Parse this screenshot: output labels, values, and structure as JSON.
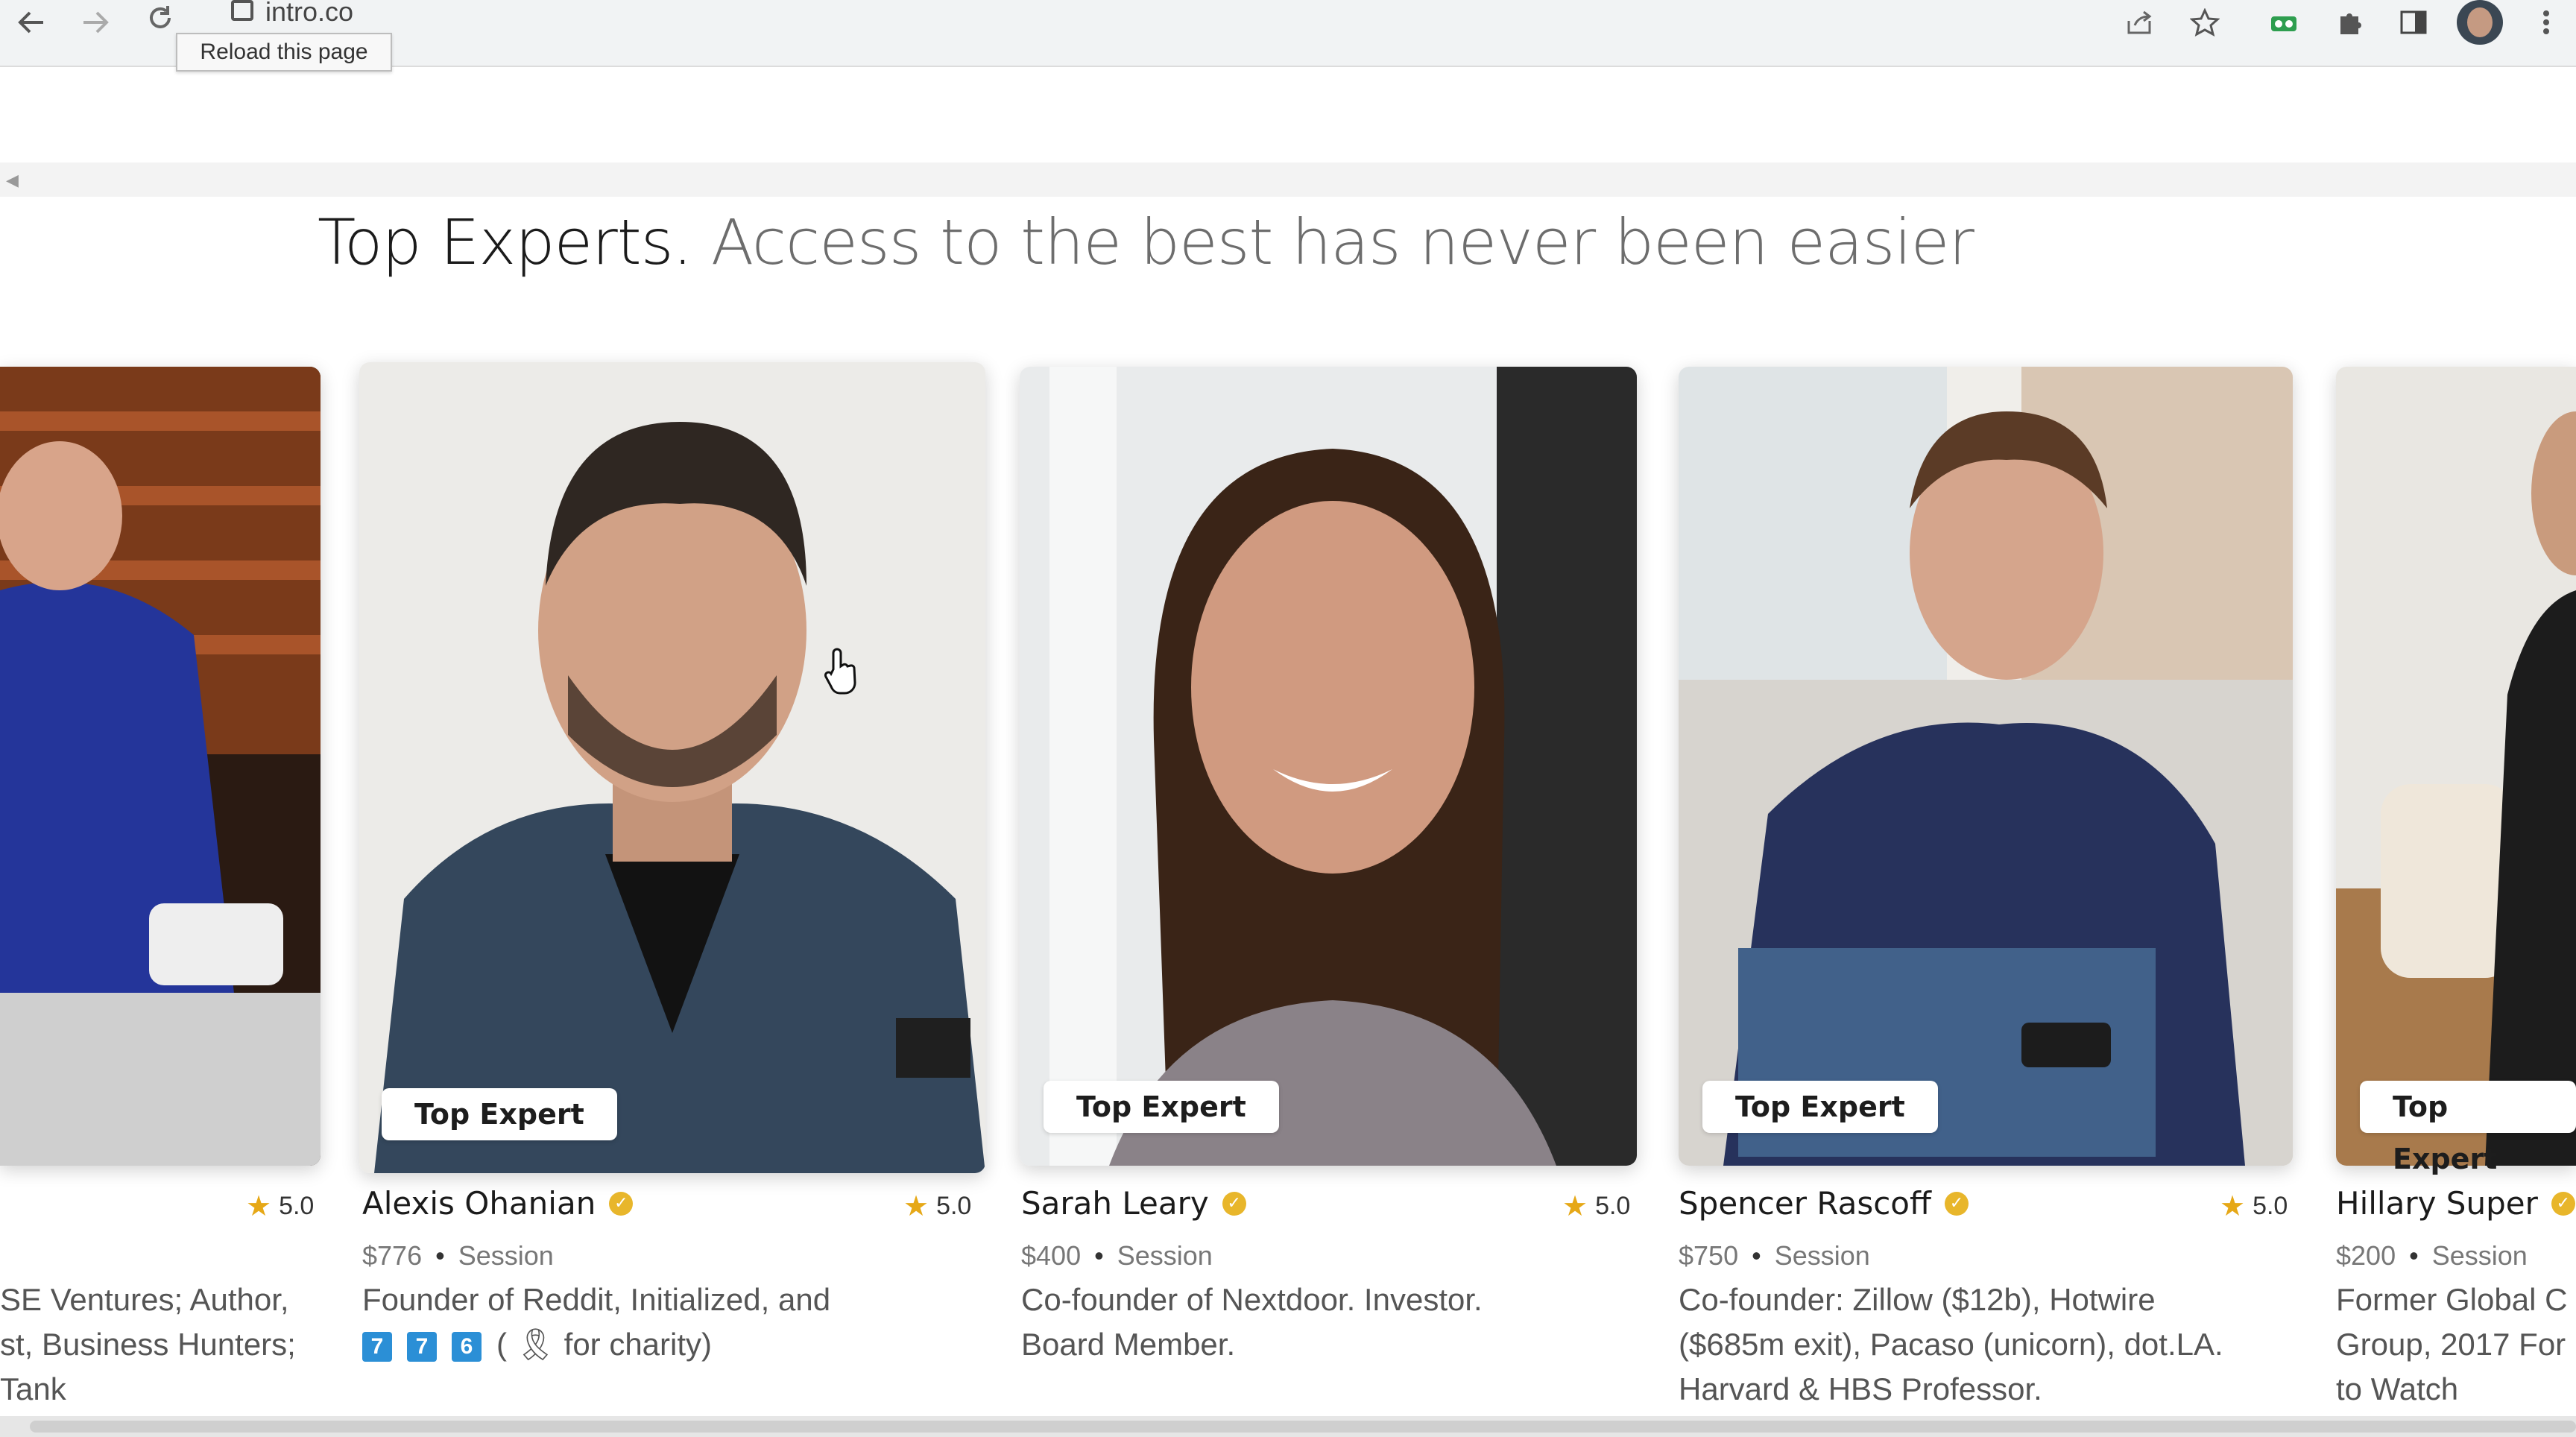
{
  "browser": {
    "url_text": "intro.co",
    "tooltip": "Reload this page"
  },
  "headline": {
    "strong": "Top Experts.",
    "light": "Access to the best has never been easier"
  },
  "badge_label": "Top Expert",
  "star_icon": "★",
  "experts": [
    {
      "rating": "5.0",
      "desc_line1": "SE Ventures; Author,",
      "desc_line2": "st, Business Hunters;",
      "desc_line3": "Tank"
    },
    {
      "name": "Alexis Ohanian",
      "rating": "5.0",
      "price": "$776",
      "unit": "Session",
      "desc_line1": "Founder of Reddit, Initialized, and",
      "tiles": [
        "7",
        "7",
        "6"
      ],
      "desc_line2_suffix": "( 🎗 for charity)"
    },
    {
      "name": "Sarah Leary",
      "rating": "5.0",
      "price": "$400",
      "unit": "Session",
      "desc_line1": "Co-founder of Nextdoor. Investor.",
      "desc_line2": "Board Member."
    },
    {
      "name": "Spencer Rascoff",
      "rating": "5.0",
      "price": "$750",
      "unit": "Session",
      "desc_line1": "Co-founder: Zillow ($12b), Hotwire",
      "desc_line2": "($685m exit), Pacaso (unicorn), dot.LA.",
      "desc_line3": "Harvard & HBS Professor."
    },
    {
      "name": "Hillary Super",
      "price": "$200",
      "unit": "Session",
      "desc_line1": "Former Global C",
      "desc_line2": "Group, 2017 For",
      "desc_line3": "to Watch"
    }
  ],
  "colors": {
    "accent_star": "#e6a817",
    "verified": "#e8b62b",
    "tile_blue": "#2b8fd6"
  }
}
